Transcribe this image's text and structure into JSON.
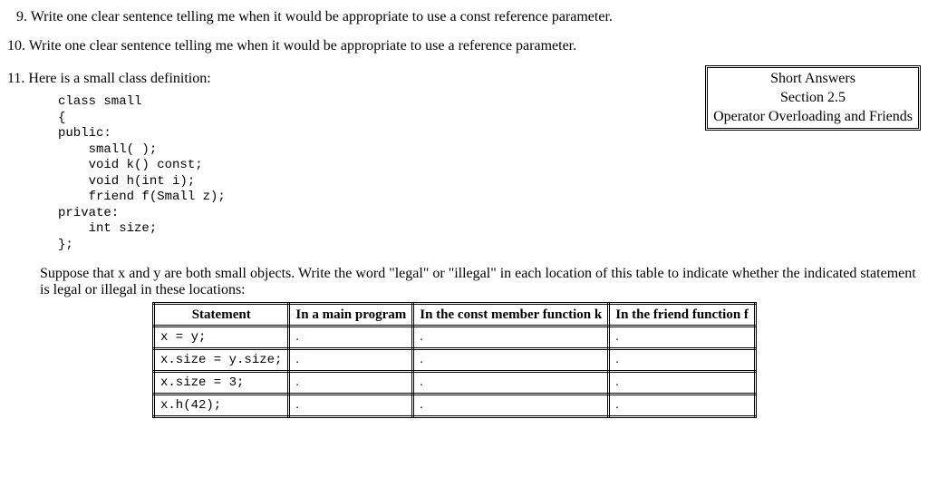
{
  "q9": {
    "num": "9.",
    "text": "Write one clear sentence telling me when it would be appropriate to use a const reference parameter."
  },
  "q10": {
    "num": "10.",
    "text": "Write one clear sentence telling me when it would be appropriate to use a reference parameter."
  },
  "q11": {
    "num": "11.",
    "text": "Here is a small class definition:"
  },
  "infobox": {
    "line1": "Short Answers",
    "line2": "Section 2.5",
    "line3": "Operator Overloading and Friends"
  },
  "code": "class small\n{\npublic:\n    small( );\n    void k() const;\n    void h(int i);\n    friend f(Small z);\nprivate:\n    int size;\n};",
  "instruction": "Suppose that x and y are both small objects. Write the word \"legal\" or \"illegal\" in each location of this table to indicate whether the indicated statement is legal or illegal in these locations:",
  "table": {
    "headers": [
      "Statement",
      "In a main program",
      "In the const member function k",
      "In the friend function f"
    ],
    "rows": [
      {
        "stmt": "x = y;",
        "c1": ".",
        "c2": ".",
        "c3": "."
      },
      {
        "stmt": "x.size = y.size;",
        "c1": ".",
        "c2": ".",
        "c3": "."
      },
      {
        "stmt": "x.size = 3;",
        "c1": ".",
        "c2": ".",
        "c3": "."
      },
      {
        "stmt": "x.h(42);",
        "c1": ".",
        "c2": ".",
        "c3": "."
      }
    ]
  }
}
